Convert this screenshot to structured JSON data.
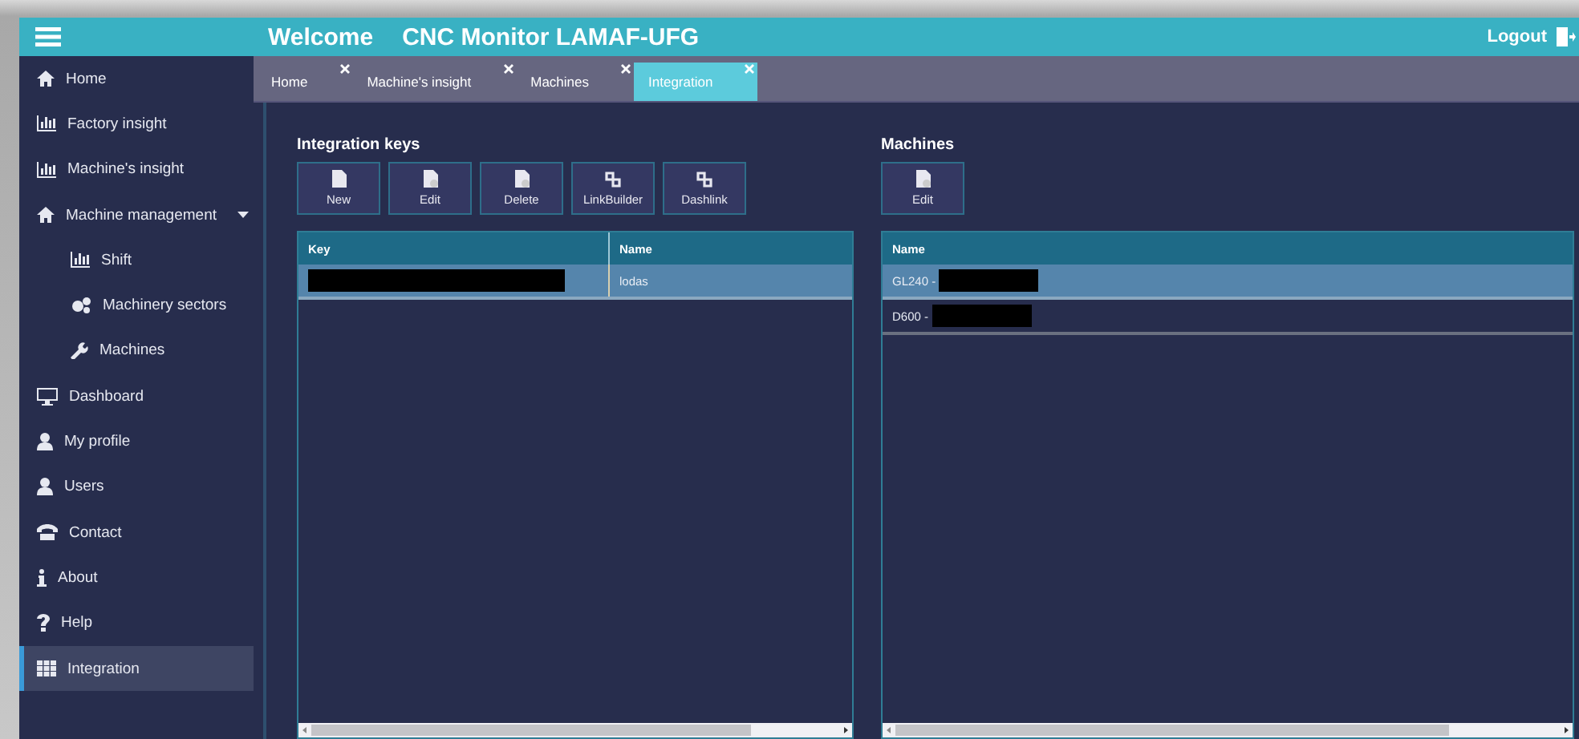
{
  "header": {
    "title": "Welcome",
    "subtitle": "CNC Monitor LAMAF-UFG",
    "logout": "Logout"
  },
  "sidebar": {
    "items": [
      {
        "label": "Home",
        "selected": false
      },
      {
        "label": "Factory insight",
        "selected": false
      },
      {
        "label": "Machine's insight",
        "selected": false
      },
      {
        "label": "Machine management",
        "selected": false,
        "expanded": true,
        "children": [
          {
            "label": "Shift",
            "selected": false
          },
          {
            "label": "Machinery sectors",
            "selected": false
          },
          {
            "label": "Machines",
            "selected": false
          }
        ]
      },
      {
        "label": "Dashboard",
        "selected": false
      },
      {
        "label": "My profile",
        "selected": false
      },
      {
        "label": "Users",
        "selected": false
      },
      {
        "label": "Contact",
        "selected": false
      },
      {
        "label": "About",
        "selected": false
      },
      {
        "label": "Help",
        "selected": false
      },
      {
        "label": "Integration",
        "selected": true
      }
    ]
  },
  "tabs": [
    {
      "label": "Home",
      "selected": false
    },
    {
      "label": "Machine's insight",
      "selected": false
    },
    {
      "label": "Machines",
      "selected": false
    },
    {
      "label": "Integration",
      "selected": true
    }
  ],
  "panels": [
    {
      "title": "Integration keys",
      "buttons": [
        "New",
        "Edit",
        "Delete",
        "LinkBuilder",
        "Dashlink"
      ],
      "table": {
        "columns": [
          "Key",
          "Name"
        ],
        "rows": [
          {
            "cells": [
              {
                "redacted": true
              },
              {
                "text": "lodas",
                "redacted": false
              }
            ],
            "selected": true
          }
        ]
      }
    },
    {
      "title": "Machines",
      "buttons": [
        "Edit"
      ],
      "table": {
        "columns": [
          "Name"
        ],
        "rows": [
          {
            "cells": [
              {
                "text": "GL240 -",
                "redacted": true
              }
            ],
            "selected": true
          },
          {
            "cells": [
              {
                "text": "D600 -",
                "redacted": true
              }
            ],
            "selected": false
          }
        ]
      }
    }
  ]
}
